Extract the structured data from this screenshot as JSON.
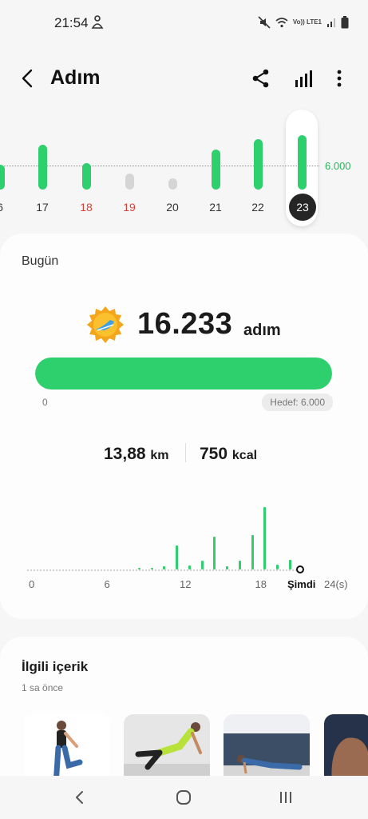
{
  "status_bar": {
    "time": "21:54",
    "network_label": "Vo)) LTE1",
    "icons": [
      "person-icon",
      "mute-icon",
      "wifi-icon",
      "signal-icon",
      "battery-icon"
    ]
  },
  "header": {
    "title": "Adım",
    "icons": [
      "back-icon",
      "share-icon",
      "bar-chart-icon",
      "more-icon"
    ]
  },
  "week_chart": {
    "goal_label": "6.000",
    "days": [
      {
        "label": "6",
        "steps_level": 0.35,
        "weekend": false
      },
      {
        "label": "17",
        "steps_level": 0.62,
        "weekend": false
      },
      {
        "label": "18",
        "steps_level": 0.37,
        "weekend": true
      },
      {
        "label": "19",
        "steps_level": 0.22,
        "weekend": true
      },
      {
        "label": "20",
        "steps_level": 0.15,
        "weekend": false
      },
      {
        "label": "21",
        "steps_level": 0.55,
        "weekend": false
      },
      {
        "label": "22",
        "steps_level": 0.7,
        "weekend": false
      },
      {
        "label": "23",
        "steps_level": 0.75,
        "weekend": false
      }
    ],
    "selected": "23",
    "colors": {
      "active": "#2ed06d",
      "inactive": "#d5d5d5",
      "weekend_text": "#d9413a"
    }
  },
  "today": {
    "title": "Bugün",
    "steps": "16.233",
    "steps_unit": "adım",
    "progress_min": "0",
    "goal": "Hedef: 6.000",
    "progress_fraction": 1.0,
    "distance": "13,88",
    "distance_unit": "km",
    "calories": "750",
    "calories_unit": "kcal"
  },
  "hourly_chart": {
    "x_ticks": [
      "0",
      "6",
      "12",
      "18"
    ],
    "now_label": "Şimdi",
    "end_label": "24(s)",
    "hours": [
      {
        "hour": 0,
        "level": 0
      },
      {
        "hour": 1,
        "level": 0
      },
      {
        "hour": 2,
        "level": 0
      },
      {
        "hour": 3,
        "level": 0
      },
      {
        "hour": 4,
        "level": 0
      },
      {
        "hour": 5,
        "level": 0
      },
      {
        "hour": 6,
        "level": 0
      },
      {
        "hour": 7,
        "level": 0
      },
      {
        "hour": 8,
        "level": 0.02
      },
      {
        "hour": 9,
        "level": 0.02
      },
      {
        "hour": 10,
        "level": 0.05
      },
      {
        "hour": 11,
        "level": 0.38
      },
      {
        "hour": 12,
        "level": 0.06
      },
      {
        "hour": 13,
        "level": 0.14
      },
      {
        "hour": 14,
        "level": 0.52
      },
      {
        "hour": 15,
        "level": 0.05
      },
      {
        "hour": 16,
        "level": 0.14
      },
      {
        "hour": 17,
        "level": 0.55
      },
      {
        "hour": 18,
        "level": 1.0
      },
      {
        "hour": 19,
        "level": 0.08
      },
      {
        "hour": 20,
        "level": 0.16
      }
    ]
  },
  "related": {
    "title": "İlgili içerik",
    "subtitle": "1 sa önce",
    "thumbnails": [
      "stretch-image",
      "plank-kick-image",
      "pushup-image",
      "arm-image"
    ]
  },
  "nav": {
    "icons": [
      "back-nav-icon",
      "home-nav-icon",
      "recents-nav-icon"
    ]
  }
}
